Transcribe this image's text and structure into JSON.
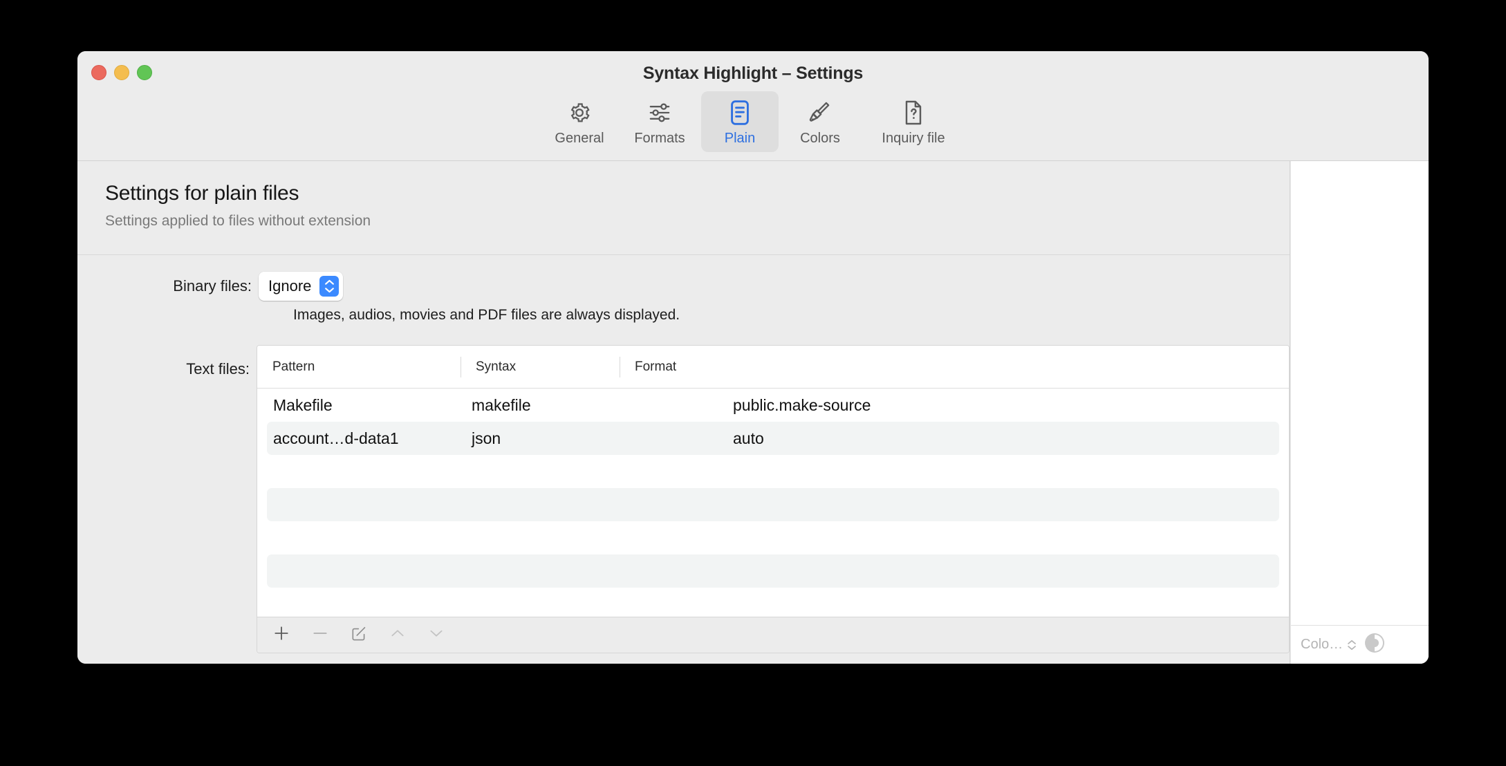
{
  "window": {
    "title": "Syntax Highlight – Settings",
    "traffic_lights": [
      "close",
      "minimize",
      "maximize"
    ]
  },
  "toolbar": {
    "tabs": [
      {
        "label": "General",
        "icon": "gear-icon",
        "selected": false
      },
      {
        "label": "Formats",
        "icon": "sliders-icon",
        "selected": false
      },
      {
        "label": "Plain",
        "icon": "document-icon",
        "selected": true
      },
      {
        "label": "Colors",
        "icon": "brush-icon",
        "selected": false
      },
      {
        "label": "Inquiry file",
        "icon": "file-question-icon",
        "selected": false
      }
    ],
    "accent_color": "#2d6fe0"
  },
  "header": {
    "title": "Settings for plain files",
    "subtitle": "Settings applied to files without extension"
  },
  "binary_files": {
    "label": "Binary files:",
    "value": "Ignore",
    "options": [
      "Ignore"
    ],
    "hint": "Images, audios, movies and PDF files are always displayed."
  },
  "text_files": {
    "label": "Text files:",
    "columns": [
      "Pattern",
      "Syntax",
      "Format"
    ],
    "rows": [
      {
        "pattern": "Makefile",
        "syntax": "makefile",
        "format": "public.make-source",
        "striped": false
      },
      {
        "pattern": "account…d-data1",
        "syntax": "json",
        "format": "auto",
        "striped": true
      },
      {
        "pattern": "",
        "syntax": "",
        "format": "",
        "striped": false
      },
      {
        "pattern": "",
        "syntax": "",
        "format": "",
        "striped": true
      },
      {
        "pattern": "",
        "syntax": "",
        "format": "",
        "striped": false
      },
      {
        "pattern": "",
        "syntax": "",
        "format": "",
        "striped": true
      }
    ],
    "footer_buttons": [
      {
        "name": "add",
        "icon": "plus-icon",
        "enabled": true
      },
      {
        "name": "remove",
        "icon": "minus-icon",
        "enabled": false
      },
      {
        "name": "edit",
        "icon": "pencil-square-icon",
        "enabled": true
      },
      {
        "name": "move-up",
        "icon": "chevron-up-icon",
        "enabled": false
      },
      {
        "name": "move-down",
        "icon": "chevron-down-icon",
        "enabled": false
      }
    ]
  },
  "side_panel": {
    "popup_value": "Colo…",
    "contrast_icon": "contrast-circle-icon"
  }
}
